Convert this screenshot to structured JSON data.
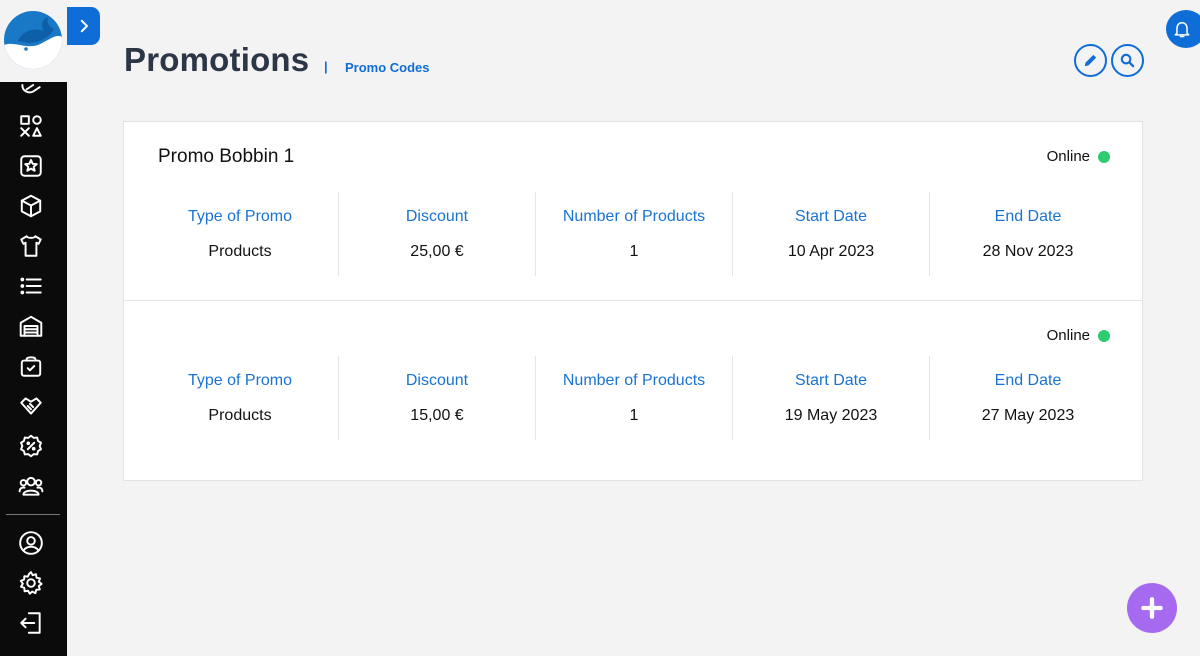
{
  "header": {
    "title": "Promotions",
    "separator": "|",
    "subtitle_link": "Promo Codes"
  },
  "sidebar": {
    "logo": "whale-logo",
    "items": [
      {
        "icon": "tag-icon"
      },
      {
        "icon": "shapes-icon"
      },
      {
        "icon": "star-box-icon"
      },
      {
        "icon": "cube-icon"
      },
      {
        "icon": "tshirt-icon"
      },
      {
        "icon": "list-icon"
      },
      {
        "icon": "warehouse-icon"
      },
      {
        "icon": "shopping-bag-icon"
      },
      {
        "icon": "handshake-icon"
      },
      {
        "icon": "discount-badge-icon"
      },
      {
        "icon": "users-icon"
      },
      {
        "icon": "user-circle-icon"
      },
      {
        "icon": "settings-icon"
      },
      {
        "icon": "logout-icon"
      }
    ]
  },
  "promos": [
    {
      "name": "Promo Bobbin 1",
      "status": "Online",
      "stats": [
        {
          "label": "Type of Promo",
          "value": "Products"
        },
        {
          "label": "Discount",
          "value": "25,00 €"
        },
        {
          "label": "Number of Products",
          "value": "1"
        },
        {
          "label": "Start Date",
          "value": "10 Apr 2023"
        },
        {
          "label": "End Date",
          "value": "28 Nov 2023"
        }
      ]
    },
    {
      "name": "",
      "status": "Online",
      "stats": [
        {
          "label": "Type of Promo",
          "value": "Products"
        },
        {
          "label": "Discount",
          "value": "15,00 €"
        },
        {
          "label": "Number of Products",
          "value": "1"
        },
        {
          "label": "Start Date",
          "value": "19 May 2023"
        },
        {
          "label": "End Date",
          "value": "27 May 2023"
        }
      ]
    }
  ],
  "colors": {
    "accent": "#0f6dd7",
    "online": "#2ecc71",
    "fab": "#a66af0",
    "sidebar": "#0b0b0b"
  }
}
